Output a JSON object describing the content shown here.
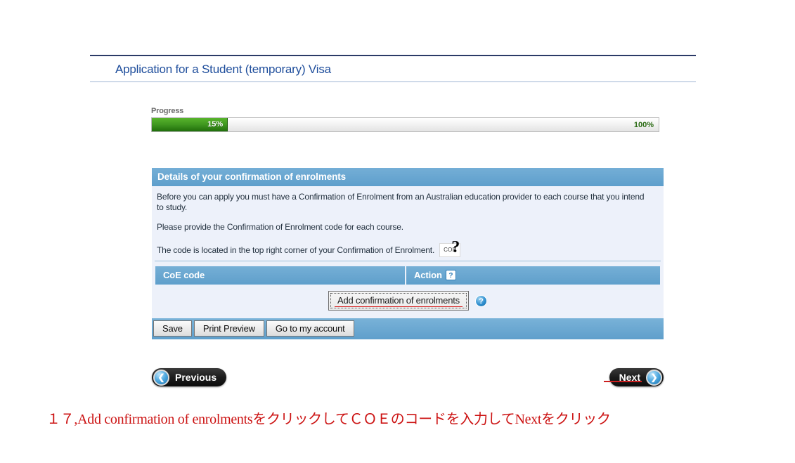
{
  "page": {
    "title": "Application for a Student (temporary) Visa"
  },
  "progress": {
    "label": "Progress",
    "value_text": "15%",
    "value": 15,
    "max_text": "100%",
    "max": 100,
    "fill_color": "#3f971f",
    "track_color": "#efefef"
  },
  "panel": {
    "header": "Details of your confirmation of enrolments",
    "accent_color": "#5f9fcb",
    "body_color": "#edf1fa",
    "paragraphs": [
      "Before you can apply you must have a Confirmation of Enrolment from an Australian education provider to each course that you intend to study.",
      "Please provide the Confirmation of Enrolment code for each course.",
      "The code is located in the top right corner of your Confirmation of Enrolment."
    ],
    "coe_hint": {
      "box_text": "COE",
      "question_mark": "?"
    }
  },
  "table": {
    "columns": [
      {
        "label": "CoE code",
        "help": false
      },
      {
        "label": "Action",
        "help": true,
        "help_glyph": "?"
      }
    ],
    "rows": []
  },
  "add_row": {
    "button_label": "Add confirmation of enrolments",
    "help_glyph": "?",
    "highlight_color": "#d62222"
  },
  "action_bar": {
    "buttons": [
      {
        "label": "Save"
      },
      {
        "label": "Print Preview"
      },
      {
        "label": "Go to my account"
      }
    ]
  },
  "navigation": {
    "previous": {
      "label": "Previous",
      "icon": "chevron-left-icon",
      "glyph": "❮"
    },
    "next": {
      "label": "Next",
      "icon": "chevron-right-icon",
      "glyph": "❯",
      "highlight_color": "#cc1f1f"
    }
  },
  "caption": {
    "text": "１７,Add confirmation of enrolmentsをクリックしてＣＯＥのコードを入力してNextをクリック",
    "color": "#cc1313"
  }
}
